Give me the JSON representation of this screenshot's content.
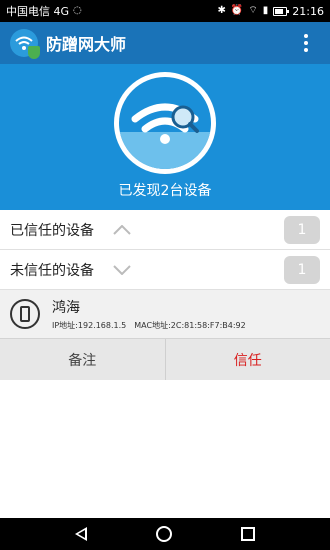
{
  "status_bar": {
    "carrier": "中国电信 4G",
    "time": "21:16",
    "icons": [
      "wifi-icon",
      "battery-icon",
      "signal-icon",
      "alarm-icon",
      "bluetooth-icon"
    ]
  },
  "app": {
    "title": "防蹭网大师",
    "logo_icon": "wifi-shield-logo-icon",
    "menu_icon": "overflow-menu-icon"
  },
  "hero": {
    "message": "已发现2台设备",
    "icon": "wifi-search-icon"
  },
  "groups": [
    {
      "label": "已信任的设备",
      "count": "1",
      "chevron": "chevron-up-icon"
    },
    {
      "label": "未信任的设备",
      "count": "1",
      "chevron": "chevron-down-icon"
    }
  ],
  "device": {
    "name": "鸿海",
    "ip_label": "IP地址:",
    "ip": "192.168.1.5",
    "mac_label": "MAC地址:",
    "mac": "2C:81:58:F7:B4:92",
    "icon": "phone-icon"
  },
  "actions": {
    "note_label": "备注",
    "trust_label": "信任"
  },
  "colors": {
    "app_bar": "#1a73b8",
    "hero_bg": "#1a8fd8",
    "trust_red": "#d81e1e",
    "badge_gray": "#d5d5d5"
  }
}
